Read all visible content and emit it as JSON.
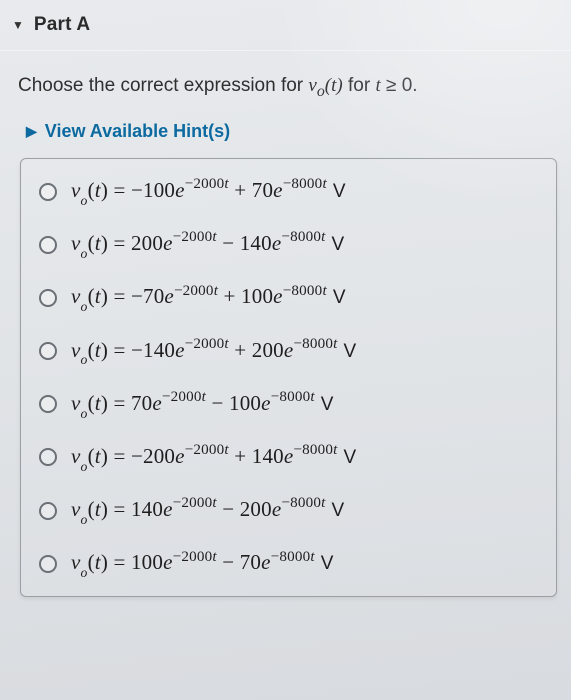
{
  "header": {
    "title": "Part A"
  },
  "prompt": {
    "lead": "Choose the correct expression for ",
    "mid": " for "
  },
  "hints": {
    "label": "View Available Hint(s)"
  },
  "unit": "V",
  "options": [
    {
      "a": "−100",
      "e1": "−2000",
      "op": "+",
      "b": "70",
      "e2": "−8000"
    },
    {
      "a": "200",
      "e1": "−2000",
      "op": "−",
      "b": "140",
      "e2": "−8000"
    },
    {
      "a": "−70",
      "e1": "−2000",
      "op": "+",
      "b": "100",
      "e2": "−8000"
    },
    {
      "a": "−140",
      "e1": "−2000",
      "op": "+",
      "b": "200",
      "e2": "−8000"
    },
    {
      "a": "70",
      "e1": "−2000",
      "op": "−",
      "b": "100",
      "e2": "−8000"
    },
    {
      "a": "−200",
      "e1": "−2000",
      "op": "+",
      "b": "140",
      "e2": "−8000"
    },
    {
      "a": "140",
      "e1": "−2000",
      "op": "−",
      "b": "200",
      "e2": "−8000"
    },
    {
      "a": "100",
      "e1": "−2000",
      "op": "−",
      "b": "70",
      "e2": "−8000"
    }
  ]
}
